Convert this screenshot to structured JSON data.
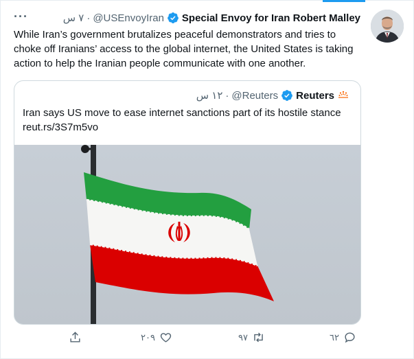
{
  "tweet": {
    "author_name": "Special Envoy for Iran Robert Malley",
    "handle": "@USEnvoyIran",
    "time": "٧ س",
    "separator": "·",
    "more_label": "···",
    "text": "While Iran’s government brutalizes peaceful demonstrators and tries to choke off Iranians’ access to the global internet, the United States is taking action to help the Iranian people communicate with one another."
  },
  "quote": {
    "author_name": "Reuters",
    "handle": "@Reuters",
    "time": "١٢ س",
    "separator": "·",
    "text": "Iran says US move to ease internet sanctions part of its hostile stance",
    "link": "reut.rs/3S7m5vo"
  },
  "actions": {
    "reply_count": "٦٢",
    "retweet_count": "٩٧",
    "like_count": "٢٠٩"
  },
  "icons": {
    "verified": "verified-badge-icon",
    "reply": "reply-icon",
    "retweet": "retweet-icon",
    "like": "heart-icon",
    "share": "share-icon",
    "more": "more-icon"
  },
  "colors": {
    "accent": "#1d9bf0",
    "muted": "#536471",
    "flag_green": "#239f40",
    "flag_white": "#ffffff",
    "flag_red": "#da0000"
  }
}
